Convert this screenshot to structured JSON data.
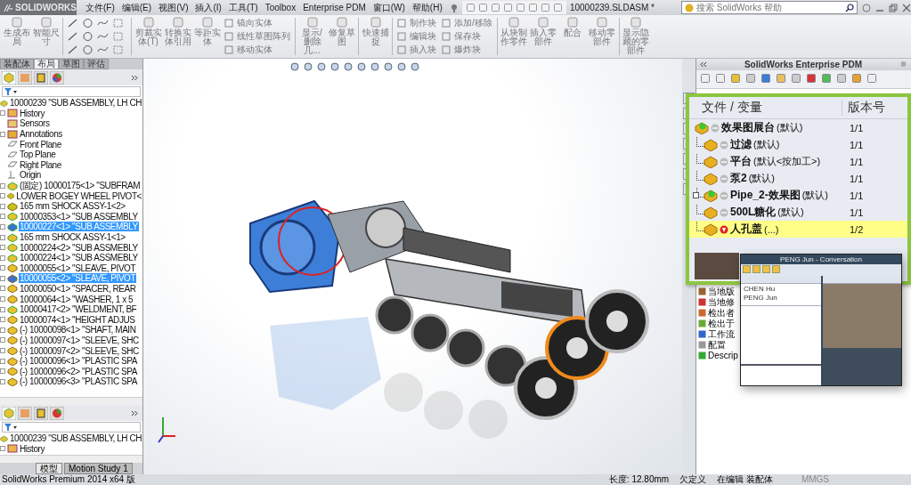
{
  "app": {
    "logo": "SOLIDWORKS",
    "title": "10000239.SLDASM *",
    "search": {
      "placeholder": "搜索 SolidWorks 帮助"
    }
  },
  "menu": [
    "文件(F)",
    "编辑(E)",
    "视图(V)",
    "插入(I)",
    "工具(T)",
    "Toolbox",
    "Enterprise PDM",
    "窗口(W)",
    "帮助(H)"
  ],
  "ribbon": [
    {
      "kind": "large",
      "label": "生成布局"
    },
    {
      "kind": "large",
      "label": "智能尺寸"
    },
    {
      "kind": "sep"
    },
    {
      "kind": "sketch"
    },
    {
      "kind": "sep"
    },
    {
      "kind": "large",
      "label": "剪裁实体(T)"
    },
    {
      "kind": "large",
      "label": "转换实体引用"
    },
    {
      "kind": "large",
      "label": "等距实体"
    },
    {
      "kind": "small",
      "items": [
        "镜向实体",
        "线性草图阵列",
        "移动实体"
      ]
    },
    {
      "kind": "sep"
    },
    {
      "kind": "large",
      "label": "显示/删除几..."
    },
    {
      "kind": "large",
      "label": "修复草图"
    },
    {
      "kind": "sep"
    },
    {
      "kind": "large",
      "label": "快速捕捉"
    },
    {
      "kind": "sep"
    },
    {
      "kind": "small",
      "items": [
        "制作块",
        "编辑块",
        "插入块"
      ]
    },
    {
      "kind": "small",
      "items": [
        "添加/移除",
        "保存块",
        "爆炸块"
      ]
    },
    {
      "kind": "sep"
    },
    {
      "kind": "large",
      "label": "从块制作零件"
    },
    {
      "kind": "large",
      "label": "插入零部件"
    },
    {
      "kind": "large",
      "label": "配合"
    },
    {
      "kind": "large",
      "label": "移动零部件"
    },
    {
      "kind": "sep"
    },
    {
      "kind": "large",
      "label": "显示隐藏的零部件"
    }
  ],
  "left_panel": {
    "tabs": [
      {
        "label": "装配体",
        "selected": false
      },
      {
        "label": "布局",
        "selected": true
      },
      {
        "label": "草图",
        "selected": false
      },
      {
        "label": "评估",
        "selected": false
      }
    ],
    "tree": {
      "root": "10000239 \"SUB ASSEMBLY, LH CH",
      "items": [
        {
          "kind": "history",
          "label": "History",
          "expandable": true,
          "selected": false
        },
        {
          "kind": "sensors",
          "label": "Sensors",
          "expandable": false,
          "selected": false
        },
        {
          "kind": "annotations",
          "label": "Annotations",
          "expandable": true,
          "selected": false
        },
        {
          "kind": "plane",
          "label": "Front Plane",
          "expandable": false,
          "selected": false
        },
        {
          "kind": "plane",
          "label": "Top Plane",
          "expandable": false,
          "selected": false
        },
        {
          "kind": "plane",
          "label": "Right Plane",
          "expandable": false,
          "selected": false
        },
        {
          "kind": "origin",
          "label": "Origin",
          "expandable": false,
          "selected": false
        },
        {
          "kind": "assembly",
          "label": "(固定) 10000175<1> \"SUBFRAM",
          "expandable": true,
          "selected": false
        },
        {
          "kind": "weldment",
          "label": "LOWER BOGEY WHEEL PIVOT<",
          "expandable": true,
          "selected": false
        },
        {
          "kind": "weldment",
          "label": "165 mm SHOCK ASSY-1<2>",
          "expandable": true,
          "selected": false
        },
        {
          "kind": "assembly",
          "label": "10000353<1> \"SUB ASSEMBLY",
          "expandable": true,
          "selected": false
        },
        {
          "kind": "assembly",
          "label": "10000227<1> \"SUB ASSEMBLY",
          "expandable": true,
          "selected": true
        },
        {
          "kind": "assembly",
          "label": "165 mm SHOCK ASSY-1<1>",
          "expandable": true,
          "selected": false
        },
        {
          "kind": "assembly",
          "label": "10000224<2> \"SUB ASSMEBLY",
          "expandable": true,
          "selected": false
        },
        {
          "kind": "assembly",
          "label": "10000224<1> \"SUB ASSMEBLY",
          "expandable": true,
          "selected": false
        },
        {
          "kind": "part",
          "label": "10000055<1> \"SLEAVE, PIVOT",
          "expandable": true,
          "selected": false
        },
        {
          "kind": "part",
          "label": "10000055<2> \"SLEAVE, PIVOT",
          "expandable": true,
          "selected": true
        },
        {
          "kind": "part",
          "label": "10000050<1> \"SPACER, REAR",
          "expandable": true,
          "selected": false
        },
        {
          "kind": "part",
          "label": "10000064<1> \"WASHER, 1 x 5",
          "expandable": true,
          "selected": false
        },
        {
          "kind": "assembly",
          "label": "10000417<2> \"WELDMENT, BF",
          "expandable": true,
          "selected": false
        },
        {
          "kind": "part",
          "label": "10000074<1> \"HEIGHT ADJUS",
          "expandable": true,
          "selected": false
        },
        {
          "kind": "part",
          "label": "(-) 10000098<1> \"SHAFT, MAIN",
          "expandable": true,
          "selected": false
        },
        {
          "kind": "part",
          "label": "(-) 10000097<1> \"SLEEVE, SHC",
          "expandable": true,
          "selected": false
        },
        {
          "kind": "part",
          "label": "(-) 10000097<2> \"SLEEVE, SHC",
          "expandable": true,
          "selected": false
        },
        {
          "kind": "part",
          "label": "(-) 10000096<1> \"PLASTIC SPA",
          "expandable": true,
          "selected": false
        },
        {
          "kind": "part",
          "label": "(-) 10000096<2> \"PLASTIC SPA",
          "expandable": true,
          "selected": false
        },
        {
          "kind": "part",
          "label": "(-) 10000096<3> \"PLASTIC SPA",
          "expandable": true,
          "selected": false
        }
      ]
    },
    "lower_tree": {
      "root": "10000239 \"SUB ASSEMBLY, LH CH",
      "items": [
        {
          "kind": "history",
          "label": "History",
          "expandable": true,
          "selected": false
        }
      ]
    },
    "bottom_tabs": [
      {
        "label": "模型",
        "selected": true
      },
      {
        "label": "Motion Study 1",
        "selected": false
      }
    ]
  },
  "pdm": {
    "title": "SolidWorks Enterprise PDM",
    "columns": [
      "文件 / 变量",
      "版本号"
    ],
    "root": {
      "name": "效果图展台",
      "config": "(默认)",
      "version": "1/1",
      "kind": "assembly",
      "checked_out": false,
      "selected": false,
      "children": [
        {
          "name": "过滤",
          "config": "(默认)",
          "version": "1/1",
          "kind": "part",
          "checked_out": false,
          "expandable": false,
          "selected": false
        },
        {
          "name": "平台",
          "config": "(默认<按加工>)",
          "version": "1/1",
          "kind": "part",
          "checked_out": false,
          "expandable": false,
          "selected": false
        },
        {
          "name": "泵2",
          "config": "(默认)",
          "version": "1/1",
          "kind": "part",
          "checked_out": false,
          "expandable": false,
          "selected": false
        },
        {
          "name": "Pipe_2-效果图",
          "config": "(默认)",
          "version": "1/1",
          "kind": "assembly",
          "checked_out": false,
          "expandable": true,
          "selected": false
        },
        {
          "name": "500L糖化",
          "config": "(默认)",
          "version": "1/1",
          "kind": "part",
          "checked_out": false,
          "expandable": false,
          "selected": false
        },
        {
          "name": "人孔盖",
          "config": "(...)",
          "version": "1/2",
          "kind": "part",
          "checked_out": true,
          "expandable": false,
          "selected": true
        }
      ]
    },
    "properties": [
      "当地版",
      "当地修",
      "检出者",
      "检出于",
      "工作流",
      "配置",
      "Descrip"
    ]
  },
  "conversation": {
    "title": "PENG Jun - Conversation",
    "contacts": [
      "CHEN Hu",
      "PENG Jun"
    ]
  },
  "status_bar": {
    "product": "SolidWorks Premium 2014 x64 版",
    "length": "长度: 12.80mm",
    "state": "欠定义",
    "mode": "在编辑 装配体",
    "units": "MMGS"
  }
}
